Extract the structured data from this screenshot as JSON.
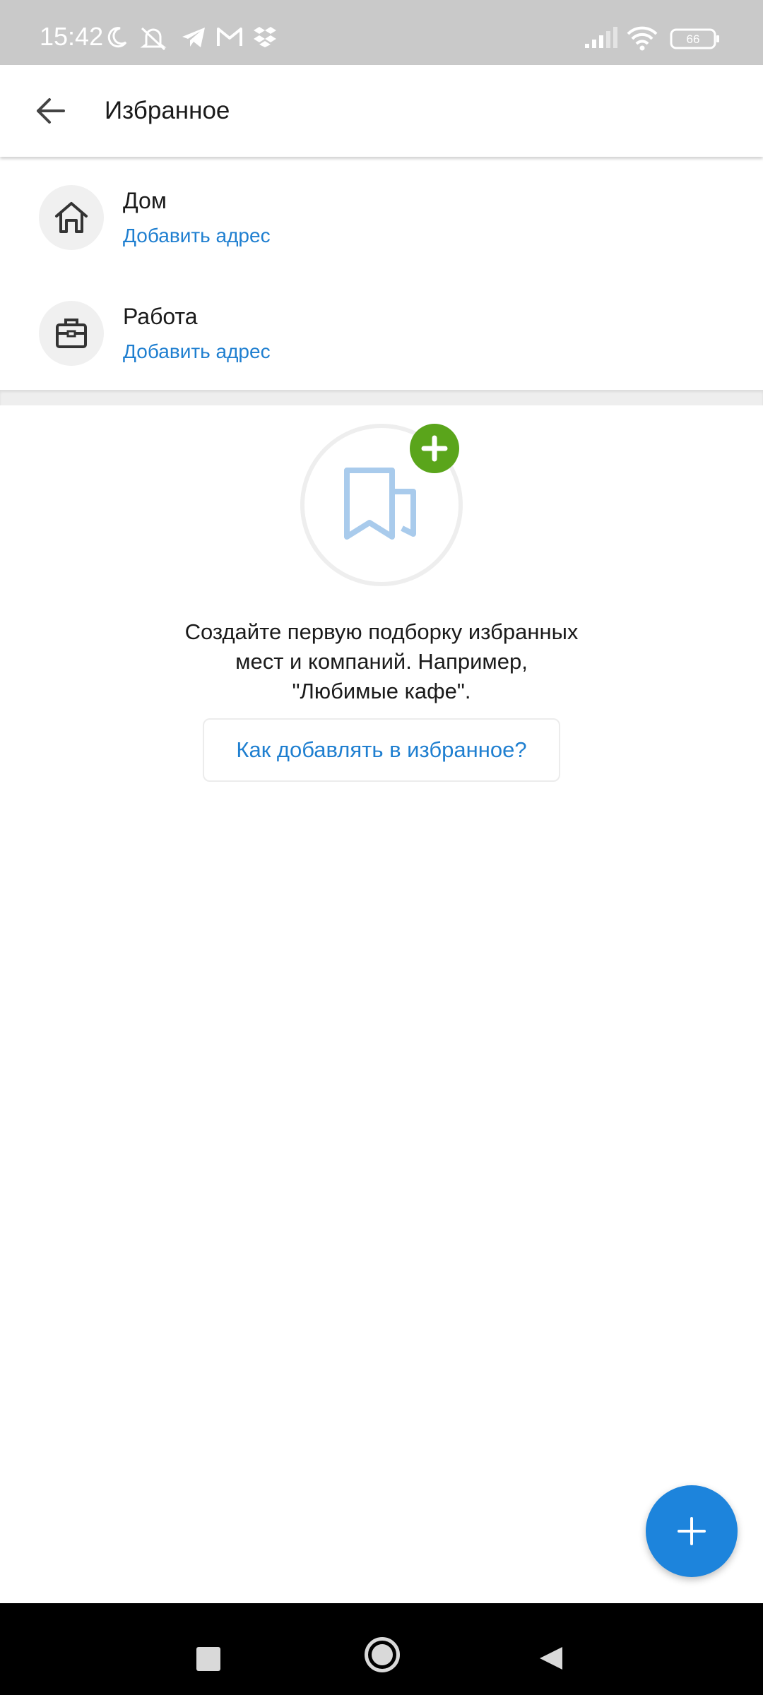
{
  "status_bar": {
    "time": "15:42",
    "battery": "66",
    "icons": [
      "moon-icon",
      "muted-bell-icon",
      "telegram-icon",
      "gmail-icon",
      "dropbox-icon",
      "signal-icon",
      "wifi-icon",
      "battery-icon"
    ]
  },
  "app_bar": {
    "title": "Избранное",
    "back_icon": "arrow-left-icon"
  },
  "favorites": [
    {
      "title": "Дом",
      "subtitle": "Добавить адрес",
      "icon": "home-icon"
    },
    {
      "title": "Работа",
      "subtitle": "Добавить адрес",
      "icon": "briefcase-icon"
    }
  ],
  "empty_state": {
    "text_line1": "Создайте первую подборку избранных",
    "text_line2": "мест и компаний. Например,",
    "text_line3": "\"Любимые кафе\".",
    "link_label": "Как добавлять в избранное?",
    "illustration_icon": "bookmarks-icon",
    "badge_icon": "plus-icon"
  },
  "fab": {
    "icon": "plus-icon"
  },
  "nav_bar": {
    "icons": [
      "recents-square-icon",
      "home-circle-icon",
      "back-triangle-icon"
    ]
  },
  "colors": {
    "accent": "#1d84dc",
    "link": "#1f7fd0",
    "badge_green": "#5aa51b",
    "status_bar_bg": "#c9c9c9"
  }
}
